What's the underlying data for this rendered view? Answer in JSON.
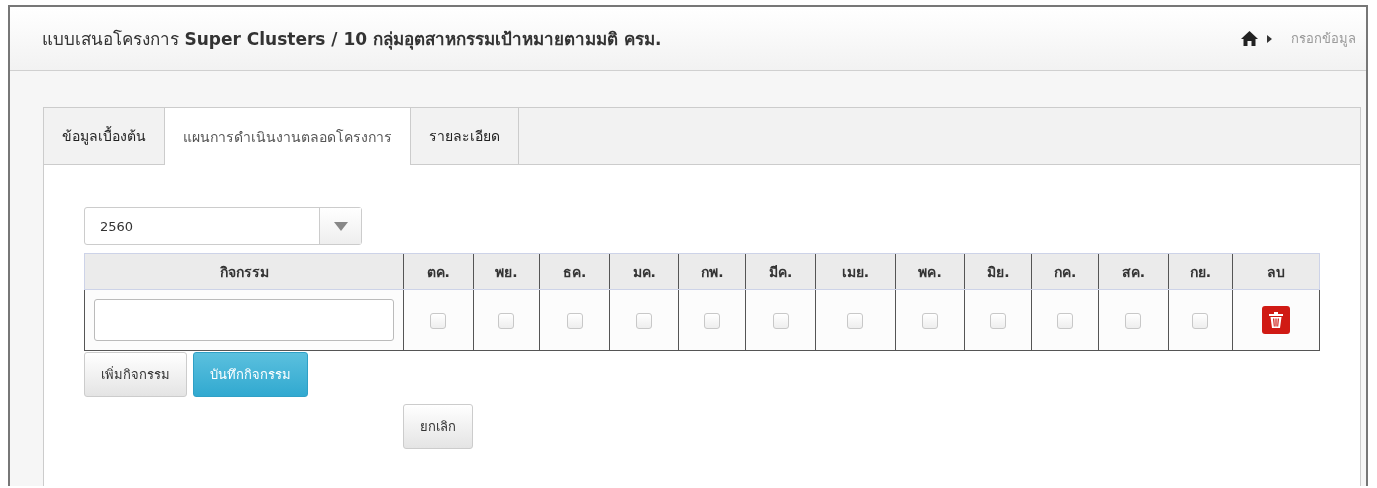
{
  "header": {
    "title": "แบบเสนอโครงการ **Super Clusters / 10 กลุ่มอุตสาหกรรมเป้าหมายตามมติ ครม.**",
    "breadcrumb": "กรอกข้อมูล"
  },
  "tabs": [
    {
      "label": "ข้อมูลเบื้องต้น",
      "selected": false
    },
    {
      "label": "แผนการดำเนินงานตลอดโครงการ",
      "selected": true
    },
    {
      "label": "รายละเอียด",
      "selected": false
    }
  ],
  "year_select": {
    "value": "2560"
  },
  "table": {
    "activity_header": "กิจกรรม",
    "months": [
      "ตค.",
      "พย.",
      "ธค.",
      "มค.",
      "กพ.",
      "มีค.",
      "เมย.",
      "พค.",
      "มิย.",
      "กค.",
      "สค.",
      "กย."
    ],
    "delete_header": "ลบ",
    "rows": [
      {
        "activity": "",
        "checks": [
          false,
          false,
          false,
          false,
          false,
          false,
          false,
          false,
          false,
          false,
          false,
          false
        ]
      }
    ]
  },
  "buttons": {
    "add": "เพิ่มกิจกรรม",
    "save": "บันทึกกิจกรรม",
    "cancel": "ยกเลิก"
  }
}
